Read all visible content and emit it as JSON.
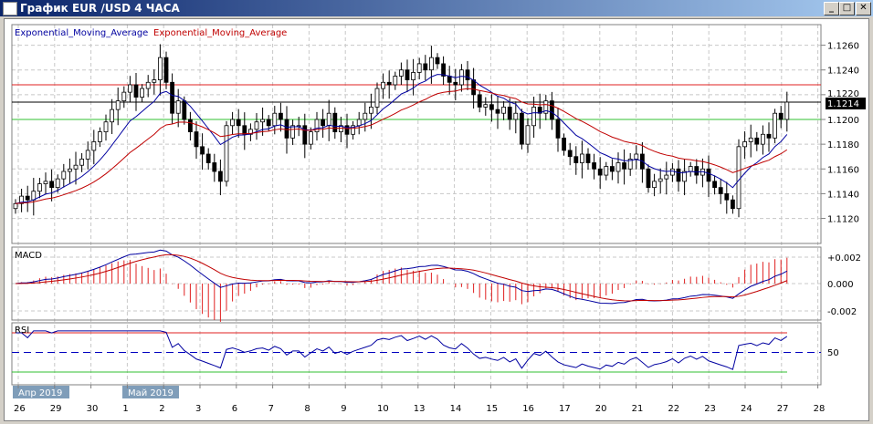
{
  "window": {
    "title": "График EUR /USD  4 ЧАСА",
    "minimize": "_",
    "maximize": "□",
    "close": "✕"
  },
  "legend": {
    "ema_fast": "Exponential_Moving_Average",
    "ema_slow": "Exponential_Moving_Average"
  },
  "colors": {
    "ema_fast": "#0000a0",
    "ema_slow": "#c00000",
    "resistance": "#e02020",
    "support": "#30c030",
    "grid": "#c8c8c8"
  },
  "price_axis": {
    "ticks": [
      "1.1260",
      "1.1240",
      "1.1220",
      "1.1200",
      "1.1180",
      "1.1160",
      "1.1140",
      "1.1120"
    ],
    "current": "1.1214"
  },
  "levels": {
    "resistance": 1.1228,
    "support": 1.12,
    "current": 1.1214
  },
  "macd": {
    "label": "MACD",
    "ticks": [
      "+0.002",
      "0.000",
      "-0.002"
    ]
  },
  "rsi": {
    "label": "RSI",
    "tick": "50",
    "upper": 70,
    "lower": 30
  },
  "x_axis": {
    "months": [
      "Апр 2019",
      "Май 2019"
    ],
    "days": [
      "26",
      "29",
      "30",
      "1",
      "2",
      "3",
      "6",
      "7",
      "8",
      "9",
      "10",
      "13",
      "14",
      "15",
      "16",
      "17",
      "20",
      "21",
      "22",
      "23",
      "24",
      "27",
      "28"
    ]
  },
  "closes": [
    1.1132,
    1.1138,
    1.1135,
    1.1142,
    1.1148,
    1.115,
    1.1145,
    1.1152,
    1.1158,
    1.116,
    1.1163,
    1.1168,
    1.1175,
    1.1182,
    1.119,
    1.1198,
    1.1208,
    1.1215,
    1.1222,
    1.1228,
    1.1218,
    1.1225,
    1.123,
    1.1232,
    1.125,
    1.123,
    1.1205,
    1.1215,
    1.12,
    1.119,
    1.1178,
    1.1172,
    1.1165,
    1.1158,
    1.115,
    1.1195,
    1.12,
    1.1195,
    1.1188,
    1.1192,
    1.1198,
    1.12,
    1.1195,
    1.1205,
    1.12,
    1.1185,
    1.1195,
    1.1195,
    1.118,
    1.119,
    1.12,
    1.1195,
    1.1205,
    1.119,
    1.1195,
    1.1188,
    1.1195,
    1.12,
    1.1205,
    1.121,
    1.1225,
    1.123,
    1.1228,
    1.1235,
    1.124,
    1.1232,
    1.1238,
    1.1245,
    1.124,
    1.125,
    1.1245,
    1.1235,
    1.123,
    1.1228,
    1.124,
    1.1232,
    1.122,
    1.121,
    1.1212,
    1.1208,
    1.1205,
    1.121,
    1.12,
    1.1205,
    1.118,
    1.1195,
    1.121,
    1.1205,
    1.1215,
    1.12,
    1.1185,
    1.1175,
    1.117,
    1.1165,
    1.1172,
    1.1165,
    1.116,
    1.1155,
    1.1162,
    1.1158,
    1.1165,
    1.116,
    1.1168,
    1.1172,
    1.116,
    1.1145,
    1.115,
    1.1152,
    1.1155,
    1.116,
    1.115,
    1.1158,
    1.1162,
    1.1155,
    1.116,
    1.115,
    1.1145,
    1.114,
    1.1135,
    1.1128,
    1.1178,
    1.1182,
    1.1185,
    1.118,
    1.1188,
    1.1185,
    1.1205,
    1.12,
    1.1214
  ]
}
